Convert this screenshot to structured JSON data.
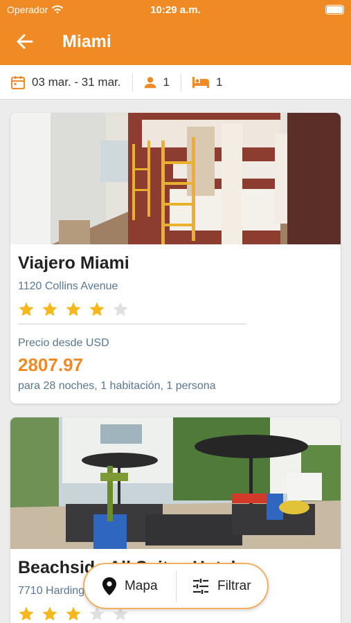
{
  "status_bar": {
    "carrier": "Operador",
    "time": "10:29 a.m."
  },
  "header": {
    "title": "Miami",
    "back_icon": "arrow-left-icon"
  },
  "filters": {
    "dates": "03 mar. - 31 mar.",
    "guests": "1",
    "rooms": "1"
  },
  "hotels": [
    {
      "name": "Viajero Miami",
      "address": "1120 Collins Avenue",
      "stars": 4,
      "max_stars": 5,
      "price_label": "Precio desde USD",
      "price": "2807.97",
      "price_desc": "para 28 noches, 1 habitación, 1 persona"
    },
    {
      "name": "Beachside All Suites Hotel",
      "address": "7710 Harding Avenue",
      "stars": 3,
      "max_stars": 5
    }
  ],
  "floating_bar": {
    "map_label": "Mapa",
    "filter_label": "Filtrar"
  },
  "colors": {
    "accent": "#f08a24",
    "star": "#f5b91e",
    "star_empty": "#e0e0e0",
    "muted_text": "#5a7690"
  }
}
